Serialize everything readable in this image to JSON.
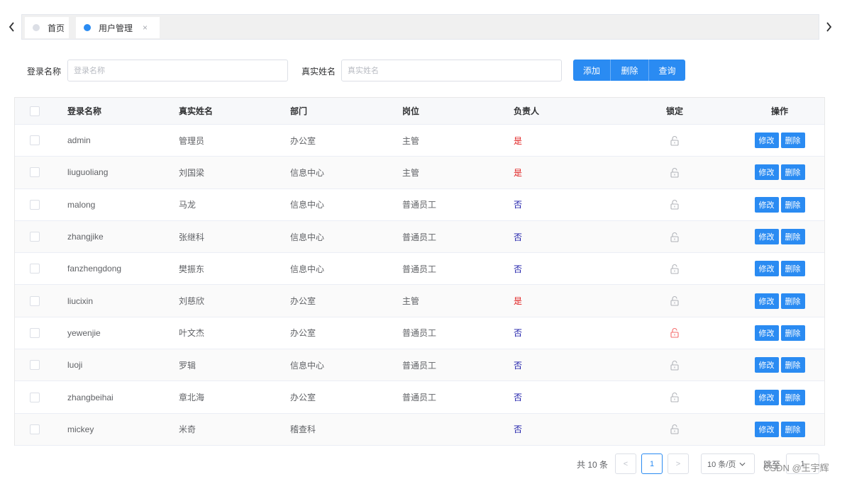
{
  "tabs": [
    {
      "label": "首页",
      "dot_color": "#dcdfe6"
    },
    {
      "label": "用户管理",
      "dot_color": "#2a8bf2",
      "close": "×"
    }
  ],
  "search": {
    "login_label": "登录名称",
    "login_placeholder": "登录名称",
    "login_value": "",
    "realname_label": "真实姓名",
    "realname_placeholder": "真实姓名",
    "realname_value": ""
  },
  "actions": {
    "add": "添加",
    "delete": "删除",
    "query": "查询"
  },
  "table": {
    "columns": [
      "登录名称",
      "真实姓名",
      "部门",
      "岗位",
      "负责人",
      "锁定",
      "操作"
    ],
    "rows": [
      {
        "login": "admin",
        "name": "管理员",
        "dept": "办公室",
        "post": "主管",
        "lead": "是",
        "locked": false,
        "edit": "修改",
        "del": "删除"
      },
      {
        "login": "liuguoliang",
        "name": "刘国梁",
        "dept": "信息中心",
        "post": "主管",
        "lead": "是",
        "locked": false,
        "edit": "修改",
        "del": "删除"
      },
      {
        "login": "malong",
        "name": "马龙",
        "dept": "信息中心",
        "post": "普通员工",
        "lead": "否",
        "locked": false,
        "edit": "修改",
        "del": "删除"
      },
      {
        "login": "zhangjike",
        "name": "张继科",
        "dept": "信息中心",
        "post": "普通员工",
        "lead": "否",
        "locked": false,
        "edit": "修改",
        "del": "删除"
      },
      {
        "login": "fanzhengdong",
        "name": "樊振东",
        "dept": "信息中心",
        "post": "普通员工",
        "lead": "否",
        "locked": false,
        "edit": "修改",
        "del": "删除"
      },
      {
        "login": "liucixin",
        "name": "刘慈欣",
        "dept": "办公室",
        "post": "主管",
        "lead": "是",
        "locked": false,
        "edit": "修改",
        "del": "删除"
      },
      {
        "login": "yewenjie",
        "name": "叶文杰",
        "dept": "办公室",
        "post": "普通员工",
        "lead": "否",
        "locked": true,
        "edit": "修改",
        "del": "删除"
      },
      {
        "login": "luoji",
        "name": "罗辑",
        "dept": "信息中心",
        "post": "普通员工",
        "lead": "否",
        "locked": false,
        "edit": "修改",
        "del": "删除"
      },
      {
        "login": "zhangbeihai",
        "name": "章北海",
        "dept": "办公室",
        "post": "普通员工",
        "lead": "否",
        "locked": false,
        "edit": "修改",
        "del": "删除"
      },
      {
        "login": "mickey",
        "name": "米奇",
        "dept": "稽查科",
        "post": "",
        "lead": "否",
        "locked": false,
        "edit": "修改",
        "del": "删除"
      }
    ]
  },
  "pagination": {
    "total": "共 10 条",
    "prev": "<",
    "current_page": "1",
    "next": ">",
    "page_size": "10 条/页",
    "jump_label": "跳至",
    "jump_value": "1"
  },
  "watermark": "CSDN @王宇辉",
  "colors": {
    "primary": "#2a8bf2",
    "yes": "#e02020",
    "no": "#1a1aa8",
    "locked": "#f56c6c",
    "unlocked": "#b0b3b8"
  }
}
